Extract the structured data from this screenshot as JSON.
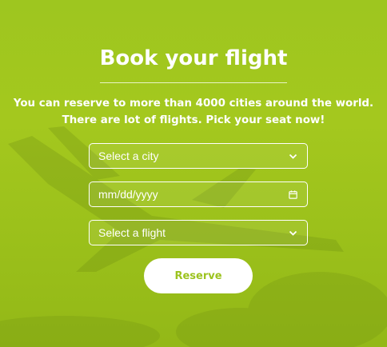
{
  "header": {
    "title": "Book your flight",
    "subtitle_line1": "You can reserve to more than 4000 cities around the world.",
    "subtitle_line2": "There are lot of flights. Pick your seat now!"
  },
  "form": {
    "city_select": {
      "selected": "Select a city",
      "icon": "chevron-down-icon"
    },
    "date_input": {
      "placeholder": "mm/dd/yyyy",
      "icon": "calendar-icon"
    },
    "flight_select": {
      "selected": "Select a flight",
      "icon": "chevron-down-icon"
    },
    "reserve_label": "Reserve"
  },
  "colors": {
    "background": "#a4c81e",
    "text": "#ffffff",
    "button_text": "#9cc31f"
  }
}
